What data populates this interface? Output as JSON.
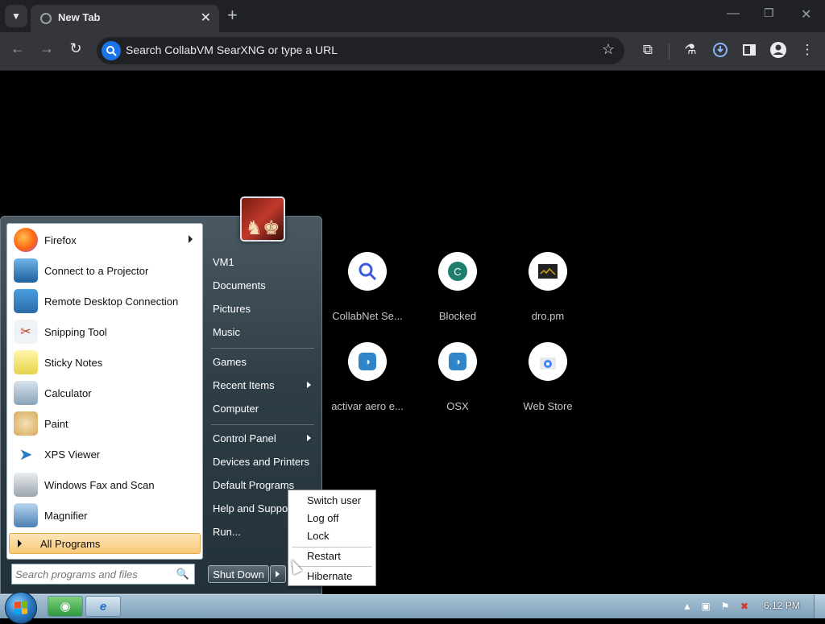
{
  "browser": {
    "tab_title": "New Tab",
    "omnibox_placeholder": "Search CollabVM SearXNG or type a URL",
    "accent": "#1a73e8"
  },
  "shortcuts": [
    {
      "label": "CollabNet Se...",
      "icon": "search-icon"
    },
    {
      "label": "Blocked",
      "icon": "letter-c-icon",
      "letter": "C"
    },
    {
      "label": "dro.pm",
      "icon": "dro-pm-icon"
    },
    {
      "label": "activar aero e...",
      "icon": "blue-fish-icon"
    },
    {
      "label": "OSX",
      "icon": "blue-fish-icon"
    },
    {
      "label": "Web Store",
      "icon": "web-store-icon"
    }
  ],
  "start_menu": {
    "programs": [
      {
        "label": "Firefox",
        "icon": "firefox-icon",
        "has_submenu": true
      },
      {
        "label": "Connect to a Projector",
        "icon": "projector-icon"
      },
      {
        "label": "Remote Desktop Connection",
        "icon": "remote-desktop-icon"
      },
      {
        "label": "Snipping Tool",
        "icon": "scissors-icon"
      },
      {
        "label": "Sticky Notes",
        "icon": "sticky-notes-icon"
      },
      {
        "label": "Calculator",
        "icon": "calculator-icon"
      },
      {
        "label": "Paint",
        "icon": "paint-icon"
      },
      {
        "label": "XPS Viewer",
        "icon": "xps-viewer-icon"
      },
      {
        "label": "Windows Fax and Scan",
        "icon": "fax-icon"
      },
      {
        "label": "Magnifier",
        "icon": "magnifier-icon"
      }
    ],
    "all_programs": "All Programs",
    "search_placeholder": "Search programs and files",
    "right_items": {
      "user": "VM1",
      "documents": "Documents",
      "pictures": "Pictures",
      "music": "Music",
      "games": "Games",
      "recent": "Recent Items",
      "computer": "Computer",
      "control_panel": "Control Panel",
      "devices": "Devices and Printers",
      "default_programs": "Default Programs",
      "help": "Help and Support",
      "run": "Run..."
    },
    "shutdown_label": "Shut Down",
    "power_menu": {
      "switch_user": "Switch user",
      "log_off": "Log off",
      "lock": "Lock",
      "restart": "Restart",
      "hibernate": "Hibernate"
    }
  },
  "taskbar": {
    "clock": "6:12 PM"
  }
}
